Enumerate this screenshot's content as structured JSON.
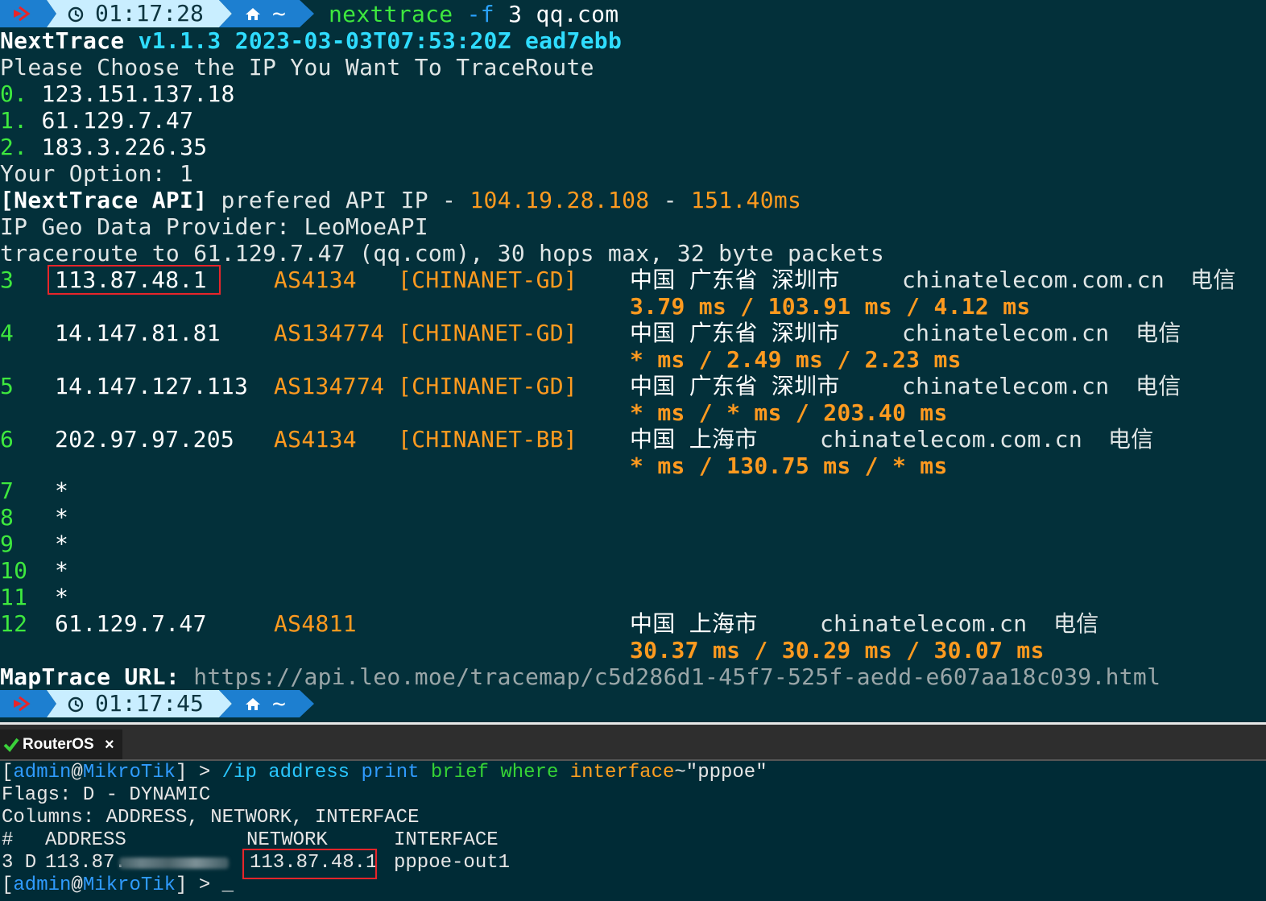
{
  "prompt1": {
    "time": "01:17:28",
    "home": "~"
  },
  "command": {
    "name": "nexttrace",
    "flag": "-f",
    "arg": "3",
    "target": "qq.com"
  },
  "header": {
    "app": "NextTrace",
    "version": "v1.1.3 2023-03-03T07:53:20Z ead7ebb"
  },
  "choose": {
    "title": "Please Choose the IP You Want To TraceRoute",
    "options": [
      {
        "idx": "0.",
        "ip": "123.151.137.18"
      },
      {
        "idx": "1.",
        "ip": "61.129.7.47"
      },
      {
        "idx": "2.",
        "ip": "183.3.226.35"
      }
    ],
    "your_option": "Your Option: 1"
  },
  "api": {
    "tag": "[NextTrace API]",
    "text": " prefered API IP - ",
    "ip": "104.19.28.108",
    "sep": " - ",
    "latency": "151.40ms"
  },
  "geo_provider": "IP Geo Data Provider: LeoMoeAPI",
  "traceroute_line": "traceroute to 61.129.7.47 (qq.com), 30 hops max, 32 byte packets",
  "hops": [
    {
      "n": "3",
      "ip": "113.87.48.1",
      "as": "AS4134",
      "net": "[CHINANET-GD]",
      "geo": "中国 广东省 深圳市",
      "domain": "chinatelecom.com.cn",
      "isp": "电信",
      "rtt": "3.79 ms / 103.91 ms / 4.12 ms"
    },
    {
      "n": "4",
      "ip": "14.147.81.81",
      "as": "AS134774",
      "net": "[CHINANET-GD]",
      "geo": "中国 广东省 深圳市",
      "domain": "chinatelecom.cn",
      "isp": "电信",
      "rtt": "* ms / 2.49 ms / 2.23 ms"
    },
    {
      "n": "5",
      "ip": "14.147.127.113",
      "as": "AS134774",
      "net": "[CHINANET-GD]",
      "geo": "中国 广东省 深圳市",
      "domain": "chinatelecom.cn",
      "isp": "电信",
      "rtt": "* ms / * ms / 203.40 ms"
    },
    {
      "n": "6",
      "ip": "202.97.97.205",
      "as": "AS4134",
      "net": "[CHINANET-BB]",
      "geo": "中国 上海市",
      "domain": "chinatelecom.com.cn",
      "isp": "电信",
      "rtt": "* ms / 130.75 ms / * ms"
    }
  ],
  "timeouts": [
    {
      "n": "7",
      "v": "*"
    },
    {
      "n": "8",
      "v": "*"
    },
    {
      "n": "9",
      "v": "*"
    },
    {
      "n": "10",
      "v": "*"
    },
    {
      "n": "11",
      "v": "*"
    }
  ],
  "last_hop": {
    "n": "12",
    "ip": "61.129.7.47",
    "as": "AS4811",
    "geo": "中国 上海市",
    "domain": "chinatelecom.cn",
    "isp": "电信",
    "rtt": "30.37 ms / 30.29 ms / 30.07 ms"
  },
  "maptrace": {
    "label": "MapTrace URL:",
    "url": "https://api.leo.moe/tracemap/c5d286d1-45f7-525f-aedd-e607aa18c039.html"
  },
  "prompt2": {
    "time": "01:17:45",
    "home": "~"
  },
  "tab": {
    "title": "RouterOS",
    "close": "×"
  },
  "routeros": {
    "user": "admin",
    "host": "MikroTik",
    "cmd_path": "/ip address",
    "cmd_print": "print",
    "cmd_brief": "brief",
    "cmd_where": "where",
    "cmd_iface": "interface",
    "cmd_op": "~",
    "cmd_val": "\"pppoe\"",
    "flags": "Flags: D - DYNAMIC",
    "columns": "Columns: ADDRESS, NETWORK, INTERFACE",
    "headers": [
      "#",
      "ADDRESS",
      "NETWORK",
      "INTERFACE"
    ],
    "row": {
      "num": "3 D",
      "address": "113.87.",
      "network": "113.87.48.1",
      "interface": "pppoe-out1"
    },
    "cursor": "_"
  },
  "colors": {
    "bg_top": "#03303a",
    "bg_bottom": "#002b36",
    "green": "#3ee83e",
    "cyan": "#2fdcff",
    "orange": "#ff9a1f",
    "highlight_red": "#e8252a",
    "prompt_blue": "#1e88d8",
    "prompt_light": "#c7ecff"
  }
}
